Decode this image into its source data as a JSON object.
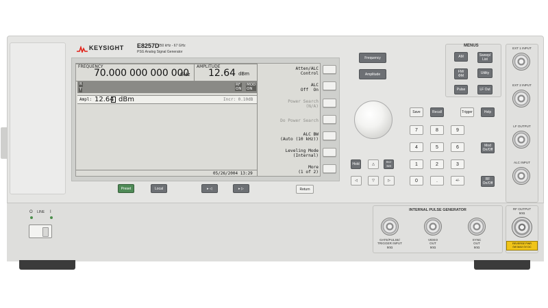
{
  "brand": {
    "name": "KEYSIGHT",
    "accent_color": "#e2231a"
  },
  "model": {
    "name": "E8257D",
    "range": "250 kHz - 67 GHz",
    "description": "PSG Analog Signal Generator"
  },
  "display": {
    "frequency_label": "FREQUENCY",
    "frequency_value": "70.000 000 000 000",
    "frequency_unit": "GHz",
    "amplitude_label": "AMPLITUDE",
    "amplitude_value": "12.64",
    "amplitude_unit": "dBm",
    "status_left_top": "R",
    "status_left_bottom": "T",
    "status_rf": "RF\nON",
    "status_mod": "MOD\nON",
    "input_label": "Ampl:",
    "input_value": "12.64",
    "input_unit": "dBm",
    "increment": "Incr: 0.10dB",
    "datetime": "05/26/2004 13:29"
  },
  "softkeys": [
    {
      "label": "Atten/ALC\nControl",
      "dimmed": false
    },
    {
      "label": "ALC\nOff  On",
      "dimmed": false
    },
    {
      "label": "Power Search\n(N/A)",
      "dimmed": true
    },
    {
      "label": "Do Power Search",
      "dimmed": true
    },
    {
      "label": "ALC BW\n(Auto (10 kHz))",
      "dimmed": false
    },
    {
      "label": "Leveling Mode\n(Internal)",
      "dimmed": false
    },
    {
      "label": "More\n(1 of 2)",
      "dimmed": false
    }
  ],
  "bottom_keys": {
    "preset": "Preset",
    "local": "Local",
    "return": "Return"
  },
  "function_keys": {
    "frequency": "Frequency",
    "amplitude": "Amplitude"
  },
  "menus": {
    "title": "MENUS",
    "items": [
      "AM",
      "Sweep/\nList",
      "FM/\nΦM",
      "Utility",
      "Pulse",
      "LF Out"
    ]
  },
  "keypad": {
    "top_row": [
      "Save",
      "Recall",
      "Trigger",
      "Help"
    ],
    "digits": [
      "7",
      "8",
      "9",
      "4",
      "5",
      "6",
      "1",
      "2",
      "3",
      "0",
      "."
    ],
    "sign": "+/-",
    "hold": "Hold",
    "incr_set": "Incr\nSet",
    "mod_onoff": "Mod\nOn/Off",
    "rf_onoff": "RF\nOn/Off"
  },
  "connectors": {
    "ext1": "EXT 1 INPUT",
    "ext2": "EXT 2 INPUT",
    "lf_output": "LF OUTPUT",
    "alc_input": "ALC INPUT",
    "pulse_title": "INTERNAL PULSE GENERATOR",
    "gate": "GATE/PULSE/\nTRIGGER INPUT",
    "gate_imp": "50Ω",
    "video": "VIDEO\nOUT",
    "video_imp": "50Ω",
    "sync": "SYNC\nOUT",
    "sync_imp": "50Ω",
    "rf_output": "RF OUTPUT",
    "rf_imp": "50Ω",
    "warning": "REVERSE PWR\n0W MAX 0V DC"
  },
  "power": {
    "label": "LINE",
    "off": "O",
    "on": "I"
  }
}
